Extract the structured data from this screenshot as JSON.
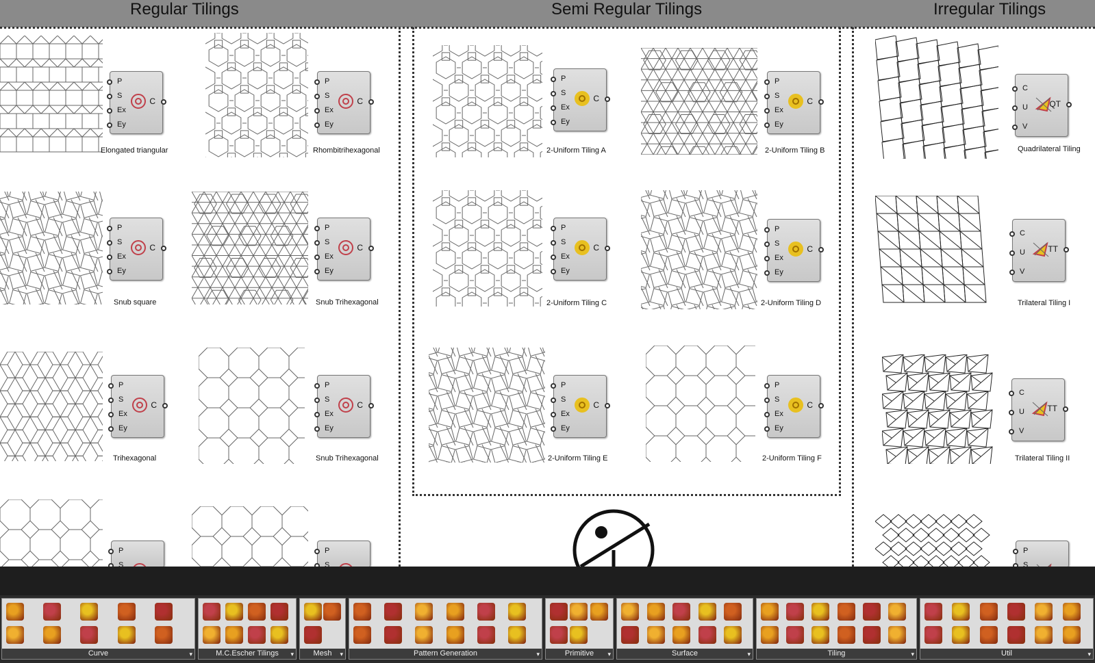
{
  "sections": {
    "regular": "Regular Tilings",
    "semi": "Semi Regular Tilings",
    "irregular": "Irregular Tilings"
  },
  "node_inputs": {
    "standard": [
      "P",
      "S",
      "Ex",
      "Ey"
    ],
    "uv": [
      "C",
      "U",
      "V"
    ],
    "partial": [
      "P",
      "S"
    ]
  },
  "tiles": {
    "regular": [
      {
        "caption": "Elongated triangular",
        "out": "C",
        "pattern": "elongated"
      },
      {
        "caption": "Rhombitrihexagonal",
        "out": "C",
        "pattern": "rhombi"
      },
      {
        "caption": "Snub square",
        "out": "C",
        "pattern": "snubsq"
      },
      {
        "caption": "Snub Trihexagonal",
        "out": "C",
        "pattern": "snubtri"
      },
      {
        "caption": "Trihexagonal",
        "out": "C",
        "pattern": "trihex"
      },
      {
        "caption": "Snub Trihexagonal",
        "out": "C",
        "pattern": "truncsq"
      },
      {
        "caption": "",
        "out": "",
        "pattern": "octagon"
      },
      {
        "caption": "",
        "out": "",
        "pattern": "octagon2"
      }
    ],
    "semi": [
      {
        "caption": "2-Uniform Tiling A",
        "out": "C",
        "pattern": "u2a"
      },
      {
        "caption": "2-Uniform Tiling B",
        "out": "C",
        "pattern": "u2b"
      },
      {
        "caption": "2-Uniform Tiling C",
        "out": "C",
        "pattern": "u2c"
      },
      {
        "caption": "2-Uniform Tiling D",
        "out": "C",
        "pattern": "u2d"
      },
      {
        "caption": "2-Uniform Tiling E",
        "out": "C",
        "pattern": "u2e"
      },
      {
        "caption": "2-Uniform Tiling F",
        "out": "C",
        "pattern": "u2f"
      }
    ],
    "irregular": [
      {
        "caption": "Quadrilateral Tiling",
        "out": "QT",
        "pattern": "quad"
      },
      {
        "caption": "Trilateral Tiling I",
        "out": "TT",
        "pattern": "tri1"
      },
      {
        "caption": "Trilateral Tiling II",
        "out": "TT",
        "pattern": "tri2"
      },
      {
        "caption": "",
        "out": "P",
        "pattern": "rhombus"
      }
    ]
  },
  "ribbon": {
    "groups": [
      "Curve",
      "M.C.Escher Tilings",
      "Mesh",
      "Pattern Generation",
      "Primitive",
      "Surface",
      "Tiling",
      "Util"
    ]
  },
  "colors": {
    "header_bar": "#8a8a8a",
    "accent_red": "#c0404a",
    "accent_yellow": "#e8c020",
    "ribbon_label_bg": "#3c3c3c"
  }
}
